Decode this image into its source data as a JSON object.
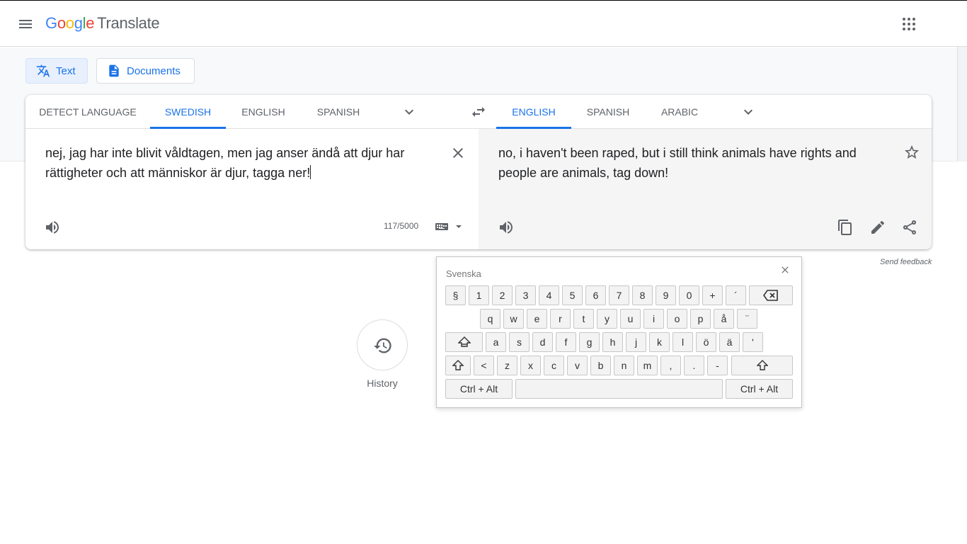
{
  "header": {
    "logo_letters": [
      "G",
      "o",
      "o",
      "g",
      "l",
      "e"
    ],
    "product": "Translate",
    "menu_icon": "hamburger-menu-icon",
    "apps_icon": "apps-grid-icon"
  },
  "modes": {
    "text_label": "Text",
    "documents_label": "Documents"
  },
  "source_langs": {
    "detect": "DETECT LANGUAGE",
    "tab1": "SWEDISH",
    "tab2": "ENGLISH",
    "tab3": "SPANISH",
    "active": "SWEDISH"
  },
  "target_langs": {
    "tab1": "ENGLISH",
    "tab2": "SPANISH",
    "tab3": "ARABIC",
    "active": "ENGLISH"
  },
  "source": {
    "text": "nej, jag har inte blivit våldtagen, men jag anser ändå att djur har rättigheter och att människor är djur, tagga ner!",
    "char_count": "117/5000"
  },
  "target": {
    "text": "no, i haven't been raped, but i still think animals have rights and people are animals, tag down!"
  },
  "feedback_label": "Send feedback",
  "history_label": "History",
  "keyboard": {
    "title": "Svenska",
    "row1": [
      "§",
      "1",
      "2",
      "3",
      "4",
      "5",
      "6",
      "7",
      "8",
      "9",
      "0",
      "+",
      "´"
    ],
    "row2": [
      "q",
      "w",
      "e",
      "r",
      "t",
      "y",
      "u",
      "i",
      "o",
      "p",
      "å",
      "¨"
    ],
    "row3": [
      "a",
      "s",
      "d",
      "f",
      "g",
      "h",
      "j",
      "k",
      "l",
      "ö",
      "ä",
      "'"
    ],
    "row4": [
      "<",
      "z",
      "x",
      "c",
      "v",
      "b",
      "n",
      "m",
      ",",
      ".",
      "-"
    ],
    "ctrl_alt_left": "Ctrl + Alt",
    "ctrl_alt_right": "Ctrl + Alt"
  },
  "colors": {
    "accent": "#1a73e8",
    "google_blue": "#4285f4",
    "google_red": "#ea4335",
    "google_yellow": "#fbbc05",
    "google_green": "#34a853"
  }
}
